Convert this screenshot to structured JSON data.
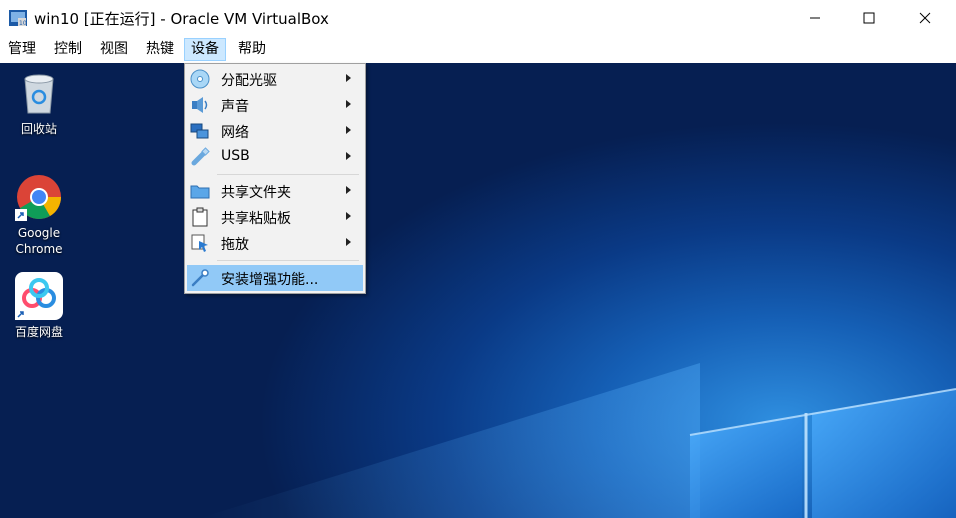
{
  "window": {
    "title": "win10 [正在运行] - Oracle VM VirtualBox"
  },
  "menubar": {
    "items": [
      "管理",
      "控制",
      "视图",
      "热键",
      "设备",
      "帮助"
    ]
  },
  "devices_menu": {
    "items": [
      {
        "label": "分配光驱",
        "icon": "optical-drive-icon",
        "submenu": true
      },
      {
        "label": "声音",
        "icon": "audio-icon",
        "submenu": true
      },
      {
        "label": "网络",
        "icon": "network-icon",
        "submenu": true
      },
      {
        "label": "USB",
        "icon": "usb-icon",
        "submenu": true
      },
      {
        "label": "共享文件夹",
        "icon": "shared-folder-icon",
        "submenu": true
      },
      {
        "label": "共享粘贴板",
        "icon": "clipboard-icon",
        "submenu": true
      },
      {
        "label": "拖放",
        "icon": "drag-drop-icon",
        "submenu": true
      },
      {
        "label": "安装增强功能...",
        "icon": "guest-additions-icon",
        "submenu": false,
        "highlighted": true
      }
    ]
  },
  "desktop": {
    "icons": [
      {
        "label": "回收站",
        "icon": "recycle-bin-icon"
      },
      {
        "label": "Google Chrome",
        "icon": "chrome-icon"
      },
      {
        "label": "百度网盘",
        "icon": "baidu-netdisk-icon"
      }
    ]
  }
}
